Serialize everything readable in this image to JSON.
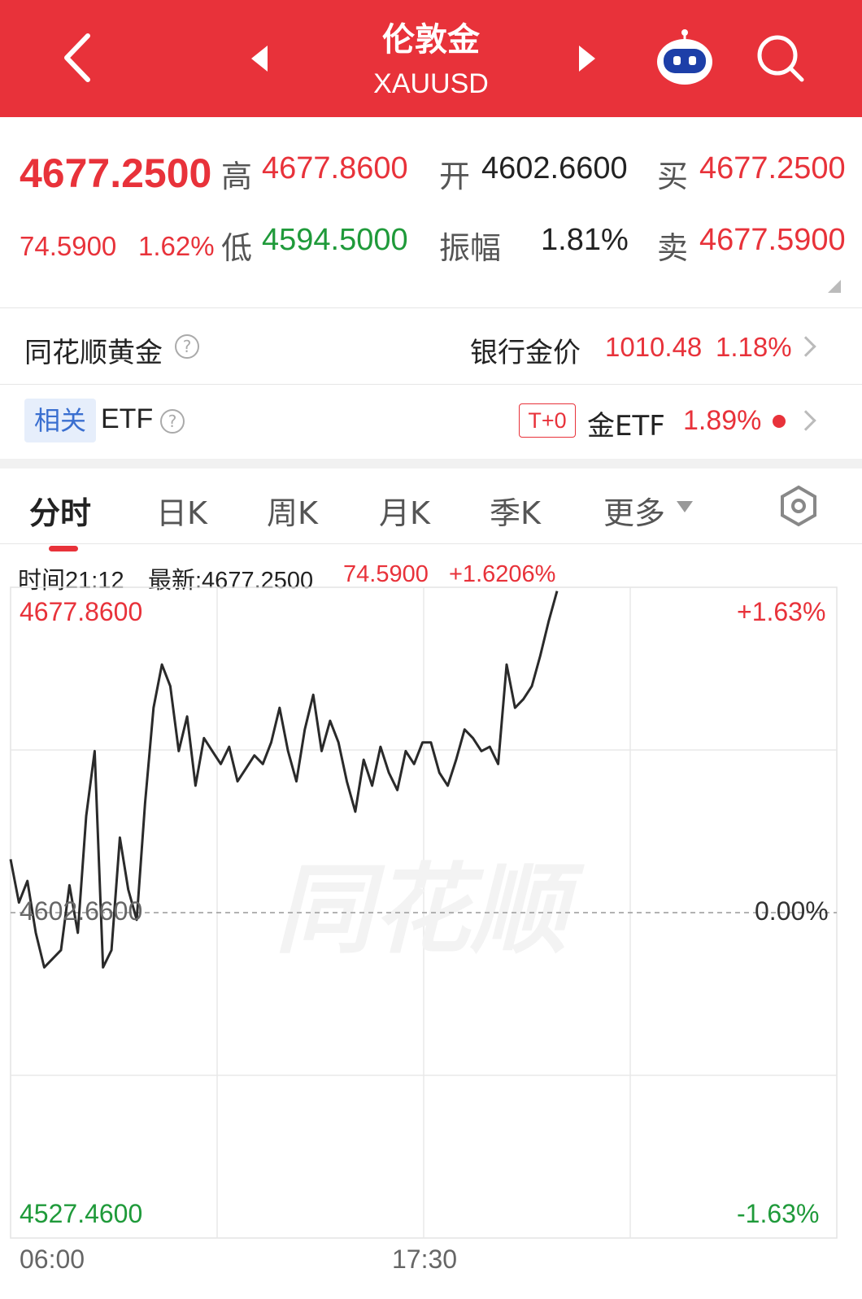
{
  "header": {
    "title": "伦敦金",
    "symbol": "XAUUSD",
    "back_icon": "chevron-left-icon",
    "prev_icon": "triangle-left-icon",
    "next_icon": "triangle-right-icon",
    "assistant_icon": "robot-icon",
    "search_icon": "search-icon",
    "color": "#e8323a"
  },
  "quote": {
    "price": "4677.2500",
    "change": "74.5900",
    "change_pct": "1.62%",
    "high_label": "高",
    "high": "4677.8600",
    "low_label": "低",
    "low": "4594.5000",
    "open_label": "开",
    "open": "4602.6600",
    "amp_label": "振幅",
    "amp": "1.81%",
    "buy_label": "买",
    "buy": "4677.2500",
    "sell_label": "卖",
    "sell": "4677.5900"
  },
  "gold_row": {
    "label": "同花顺黄金",
    "bank_label": "银行金价",
    "bank_price": "1010.48",
    "bank_pct": "1.18%"
  },
  "etf_row": {
    "tag": "相关",
    "label": "ETF",
    "badge": "T+0",
    "name": "金ETF",
    "pct": "1.89%"
  },
  "tabs": [
    "分时",
    "日K",
    "周K",
    "月K",
    "季K",
    "更多"
  ],
  "info_bar": {
    "time": "时间21:12",
    "latest": "最新:4677.2500",
    "change": "74.5900",
    "change_pct": "+1.6206%"
  },
  "watermark": "同花顺",
  "chart_data": {
    "type": "line",
    "x_labels": [
      "06:00",
      "17:30"
    ],
    "y_left_labels": [
      "4677.8600",
      "4602.6600",
      "4527.4600"
    ],
    "y_right_labels": [
      "+1.63%",
      "0.00%",
      "-1.63%"
    ],
    "ylim": [
      4527.46,
      4677.86
    ],
    "prev_close": 4602.66,
    "series": [
      {
        "values": [
          4615,
          4605,
          4610,
          4598,
          4590,
          4592,
          4594,
          4609,
          4598,
          4625,
          4640,
          4590,
          4594,
          4620,
          4608,
          4601,
          4628,
          4650,
          4660,
          4655,
          4640,
          4648,
          4632,
          4643,
          4640,
          4637,
          4641,
          4633,
          4636,
          4639,
          4637,
          4642,
          4650,
          4640,
          4633,
          4645,
          4653,
          4640,
          4647,
          4642,
          4633,
          4626,
          4638,
          4632,
          4641,
          4635,
          4631,
          4640,
          4637,
          4642,
          4642,
          4635,
          4632,
          4638,
          4645,
          4643,
          4640,
          4641,
          4637,
          4660,
          4650,
          4652,
          4655,
          4662,
          4670,
          4677
        ]
      }
    ]
  }
}
